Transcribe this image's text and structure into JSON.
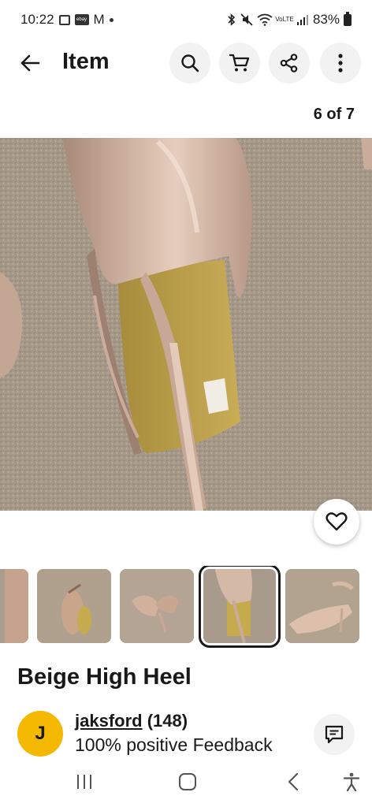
{
  "status_bar": {
    "time": "10:22",
    "ebay_badge": "ebay",
    "gmail": "M",
    "volte": "VoLTE",
    "battery": "83%"
  },
  "header": {
    "title": "Item"
  },
  "gallery": {
    "counter": "6 of 7"
  },
  "item": {
    "title": "Beige High Heel"
  },
  "seller": {
    "initial": "J",
    "name": "jaksford",
    "feedback_count": "(148)",
    "feedback": "100% positive Feedback"
  },
  "colors": {
    "accent_avatar": "#f5b800",
    "text": "#191919",
    "button_bg": "#f2f2f2"
  },
  "icons": [
    "back-arrow-icon",
    "search-icon",
    "cart-icon",
    "share-icon",
    "more-vertical-icon",
    "heart-icon",
    "message-icon",
    "recent-apps-icon",
    "home-icon",
    "back-nav-icon",
    "accessibility-icon"
  ]
}
